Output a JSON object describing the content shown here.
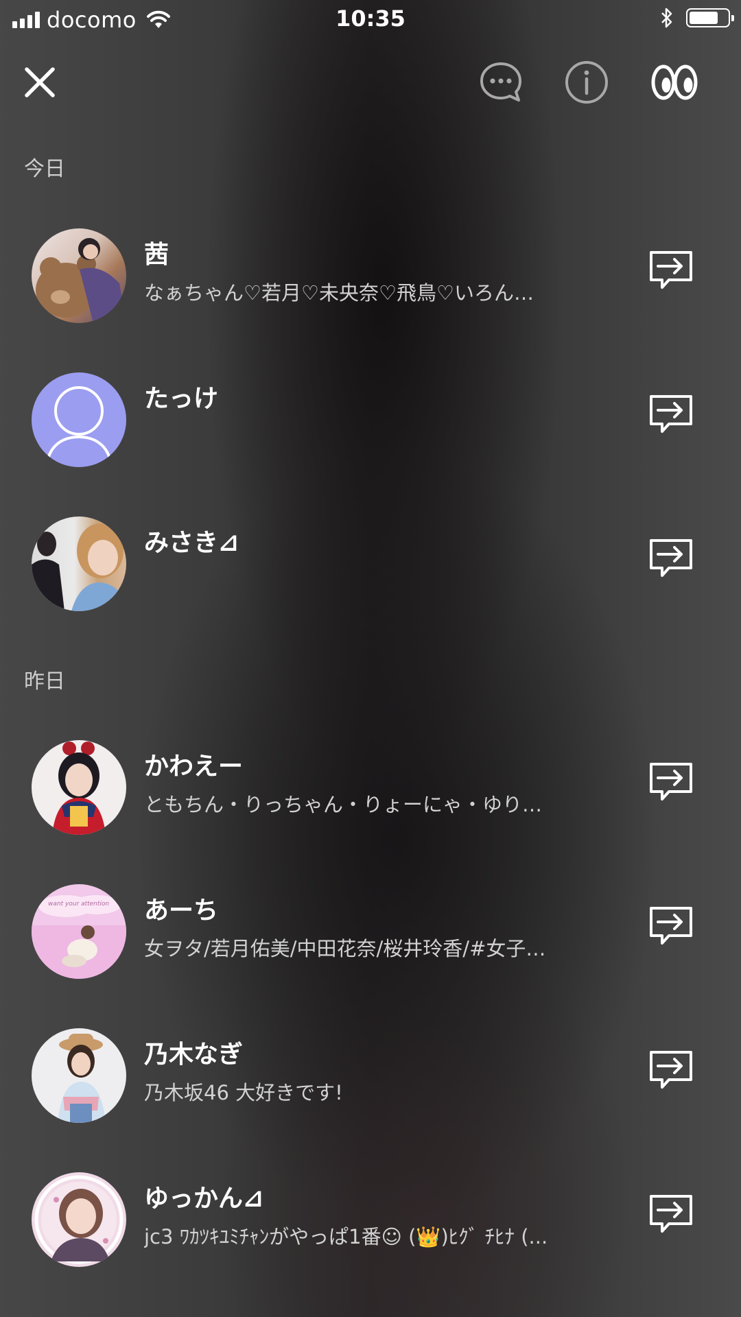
{
  "status_bar": {
    "carrier": "docomo",
    "time": "10:35",
    "battery_level": 0.75,
    "signal_bars": 4
  },
  "toolbar": {
    "icons": [
      "close-icon",
      "chat-bubble-icon",
      "info-icon",
      "eyes-icon"
    ]
  },
  "sections": [
    {
      "label": "今日",
      "friends": [
        {
          "name": "茜",
          "status": "なぁちゃん♡若月♡未央奈♡飛鳥♡いろん…",
          "avatar": "photo"
        },
        {
          "name": "たっけ",
          "status": "",
          "avatar": "default"
        },
        {
          "name": "みさき⊿",
          "status": "",
          "avatar": "photo"
        }
      ]
    },
    {
      "label": "昨日",
      "friends": [
        {
          "name": "かわえー",
          "status": "ともちん・りっちゃん・りょーにゃ・ゆり…",
          "avatar": "photo"
        },
        {
          "name": "あーち",
          "status": "女ヲタ/若月佑美/中田花奈/桜井玲香/#女子…",
          "avatar": "photo",
          "avatar_text": "want your attention"
        },
        {
          "name": "乃木なぎ",
          "status": "乃木坂46  大好きです!",
          "avatar": "photo"
        },
        {
          "name": "ゆっかん⊿",
          "status": "jc3 ﾜｶﾂｷﾕﾐﾁｬﾝがやっぱ1番☺ (👑)ﾋｸﾞ ﾁﾋﾅ (...",
          "avatar": "photo"
        }
      ]
    }
  ],
  "colors": {
    "default_avatar": "#9b9df0",
    "text": "#ffffff",
    "secondary_text": "#d2d2d2"
  }
}
